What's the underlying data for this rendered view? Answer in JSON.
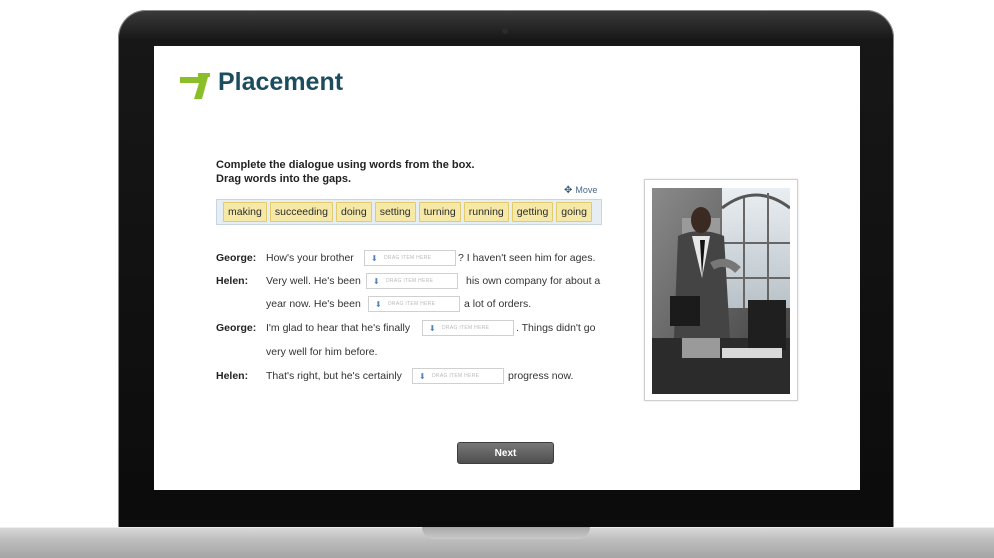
{
  "app": {
    "title": "Placement"
  },
  "instructions": {
    "line1": "Complete the dialogue using words from the box.",
    "line2": "Drag words into the gaps."
  },
  "move_label": "Move",
  "word_bank": [
    "making",
    "succeeding",
    "doing",
    "setting",
    "turning",
    "running",
    "getting",
    "going"
  ],
  "gap_placeholder": "DRAG ITEM HERE",
  "dialogue": {
    "george1": {
      "speaker": "George:",
      "before": "How's your brother",
      "after": "? I haven't seen him for ages."
    },
    "helen1": {
      "speaker": "Helen:",
      "before": "Very well. He's been",
      "after": "his own company for about a",
      "line2_before": "year now. He's been",
      "line2_after": "a lot of orders."
    },
    "george2": {
      "speaker": "George:",
      "before": "I'm glad to hear that he's finally",
      "after": ". Things didn't go",
      "line2": "very well for him before."
    },
    "helen2": {
      "speaker": "Helen:",
      "before": "That's right, but he's certainly",
      "after": "progress now."
    }
  },
  "next_label": "Next",
  "colors": {
    "brand_green": "#8bbf2a",
    "brand_teal": "#1c4d5e",
    "chip_bg": "#f6e9a8"
  },
  "icons": {
    "logo": "arrow-corner-icon",
    "move": "move-arrows-icon",
    "drop": "download-arrow-icon"
  }
}
